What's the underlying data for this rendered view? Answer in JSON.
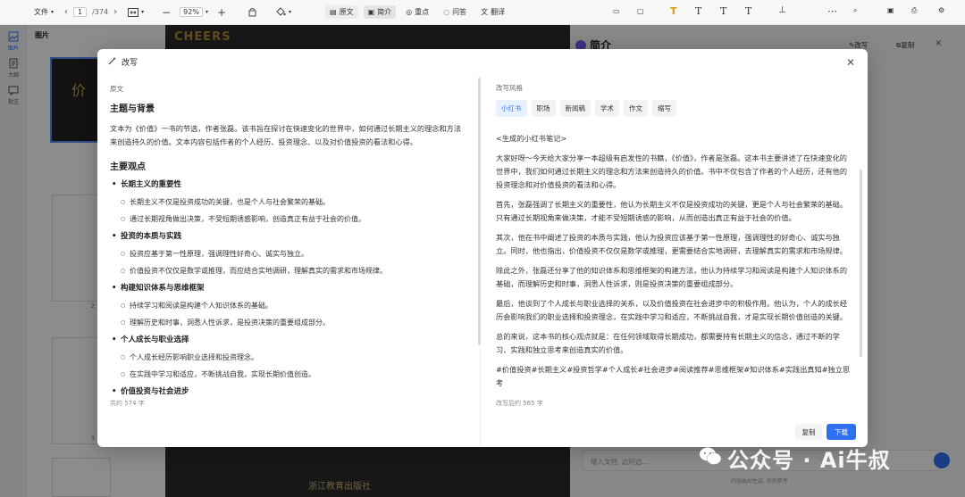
{
  "toolbar": {
    "file_label": "文件",
    "page_current": "1",
    "page_total": "/374",
    "zoom": "92%",
    "tabs": [
      "原文",
      "简介",
      "重点",
      "问答",
      "翻译"
    ]
  },
  "sidebar": {
    "items": [
      "图片",
      "大纲",
      "批注"
    ]
  },
  "thumbnails": {
    "title": "图片",
    "page_numbers": [
      "2",
      "3"
    ],
    "cover_char": "价"
  },
  "right_panel": {
    "title": "简介",
    "rewrite_label": "改写",
    "copy_label": "复制",
    "chat_placeholder": "输入文档, 边问边...",
    "disclaimer": "内容由AI生成, 仅供参考"
  },
  "document": {
    "banner_text": "CHEERS",
    "publisher": "浙江教育出版社"
  },
  "modal": {
    "title": "改写",
    "left": {
      "label": "原文",
      "heading": "主题与背景",
      "intro": "文本为《价值》一书的节选，作者张磊。该书旨在探讨在快速变化的世界中，如何通过长期主义的理念和方法来创造持久的价值。文本内容包括作者的个人经历、投资理念、以及对价值投资的看法和心得。",
      "section_title": "主要观点",
      "points": [
        {
          "title": "长期主义的重要性",
          "subs": [
            "长期主义不仅是投资成功的关键，也是个人与社会繁荣的基础。",
            "通过长期视角做出决策，不受短期诱惑影响，创造真正有益于社会的价值。"
          ]
        },
        {
          "title": "投资的本质与实践",
          "subs": [
            "投资应基于第一性原理，强调理性好奇心、诚实与独立。",
            "价值投资不仅仅是数学或推理，而应结合实地调研，理解真实的需求和市场规律。"
          ]
        },
        {
          "title": "构建知识体系与思维框架",
          "subs": [
            "持续学习和阅读是构建个人知识体系的基础。",
            "理解历史和时事，洞悉人性诉求，是投资决策的重要组成部分。"
          ]
        },
        {
          "title": "个人成长与职业选择",
          "subs": [
            "个人成长经历影响职业选择和投资理念。",
            "在实践中学习和适应，不断挑战自我，实现长期价值创造。"
          ]
        },
        {
          "title": "价值投资与社会进步",
          "subs": []
        }
      ],
      "word_count": "共约 574 字"
    },
    "right": {
      "label": "改写风格",
      "styles": [
        "小红书",
        "职场",
        "新闻稿",
        "学术",
        "作文",
        "缩写"
      ],
      "active_style": "小红书",
      "paragraphs": [
        "<生成的小红书笔记>",
        "大家好呀～今天给大家分享一本超级有启发性的书籍，《价值》，作者是张磊。这本书主要讲述了在快速变化的世界中，我们如何通过长期主义的理念和方法来创造持久的价值。书中不仅包含了作者的个人经历，还有他的投资理念和对价值投资的看法和心得。",
        "首先，张磊强调了长期主义的重要性，他认为长期主义不仅是投资成功的关键，更是个人与社会繁荣的基础。只有通过长期视角来做决策，才能不受短期诱惑的影响，从而创造出真正有益于社会的价值。",
        "其次，他在书中阐述了投资的本质与实践，他认为投资应该基于第一性原理，强调理性的好奇心、诚实与独立。同时，他也指出，价值投资不仅仅是数学或推理，更需要结合实地调研，去理解真实的需求和市场规律。",
        "除此之外，张磊还分享了他的知识体系和思维框架的构建方法，他认为持续学习和阅读是构建个人知识体系的基础，而理解历史和时事，洞悉人性诉求，则是投资决策的重要组成部分。",
        "最后，他谈到了个人成长与职业选择的关系，以及价值投资在社会进步中的积极作用。他认为，个人的成长经历会影响我们的职业选择和投资理念，在实践中学习和适应，不断挑战自我，才是实现长期价值创造的关键。",
        "总的来说，这本书的核心观点就是：在任何领域取得长期成功，都需要持有长期主义的信念，通过不断的学习、实践和独立思考来创造真实的价值。",
        "#价值投资#长期主义#投资哲学#个人成长#社会进步#阅读推荐#思维框架#知识体系#实践出真知#独立思考"
      ],
      "word_count": "改写后约 565 字",
      "copy_button": "复制",
      "download_button": "下载"
    }
  },
  "watermark": {
    "text": "公众号 · Ai牛叔"
  }
}
